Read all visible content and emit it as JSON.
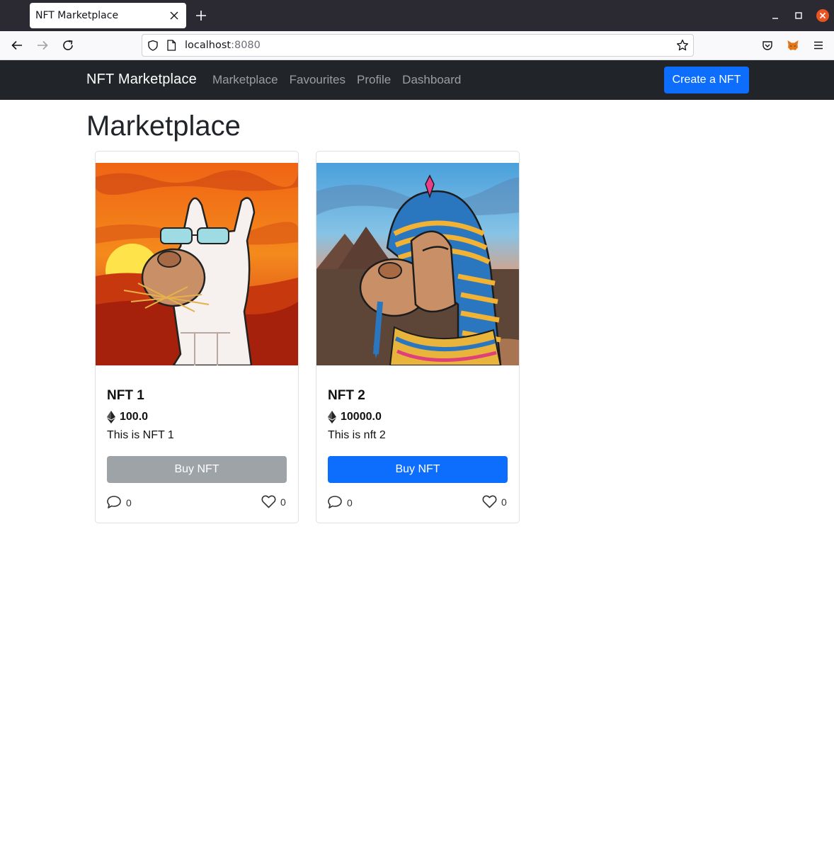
{
  "browser": {
    "tab_title": "NFT Marketplace",
    "url_host": "localhost",
    "url_port": ":8080"
  },
  "navbar": {
    "brand": "NFT Marketplace",
    "links": [
      "Marketplace",
      "Favourites",
      "Profile",
      "Dashboard"
    ],
    "create_button": "Create a NFT",
    "accent_color": "#0d6efd",
    "bg_color": "#212529"
  },
  "page": {
    "title": "Marketplace"
  },
  "cards": [
    {
      "title": "NFT 1",
      "price": "100.0",
      "description": "This is NFT 1",
      "buy_label": "Buy NFT",
      "buy_state": "disabled",
      "comments": "0",
      "likes": "0",
      "image_icon": "white-camel-sunset-artwork"
    },
    {
      "title": "NFT 2",
      "price": "10000.0",
      "description": "This is nft 2",
      "buy_label": "Buy NFT",
      "buy_state": "active",
      "comments": "0",
      "likes": "0",
      "image_icon": "pharaoh-camel-pyramids-artwork"
    }
  ]
}
